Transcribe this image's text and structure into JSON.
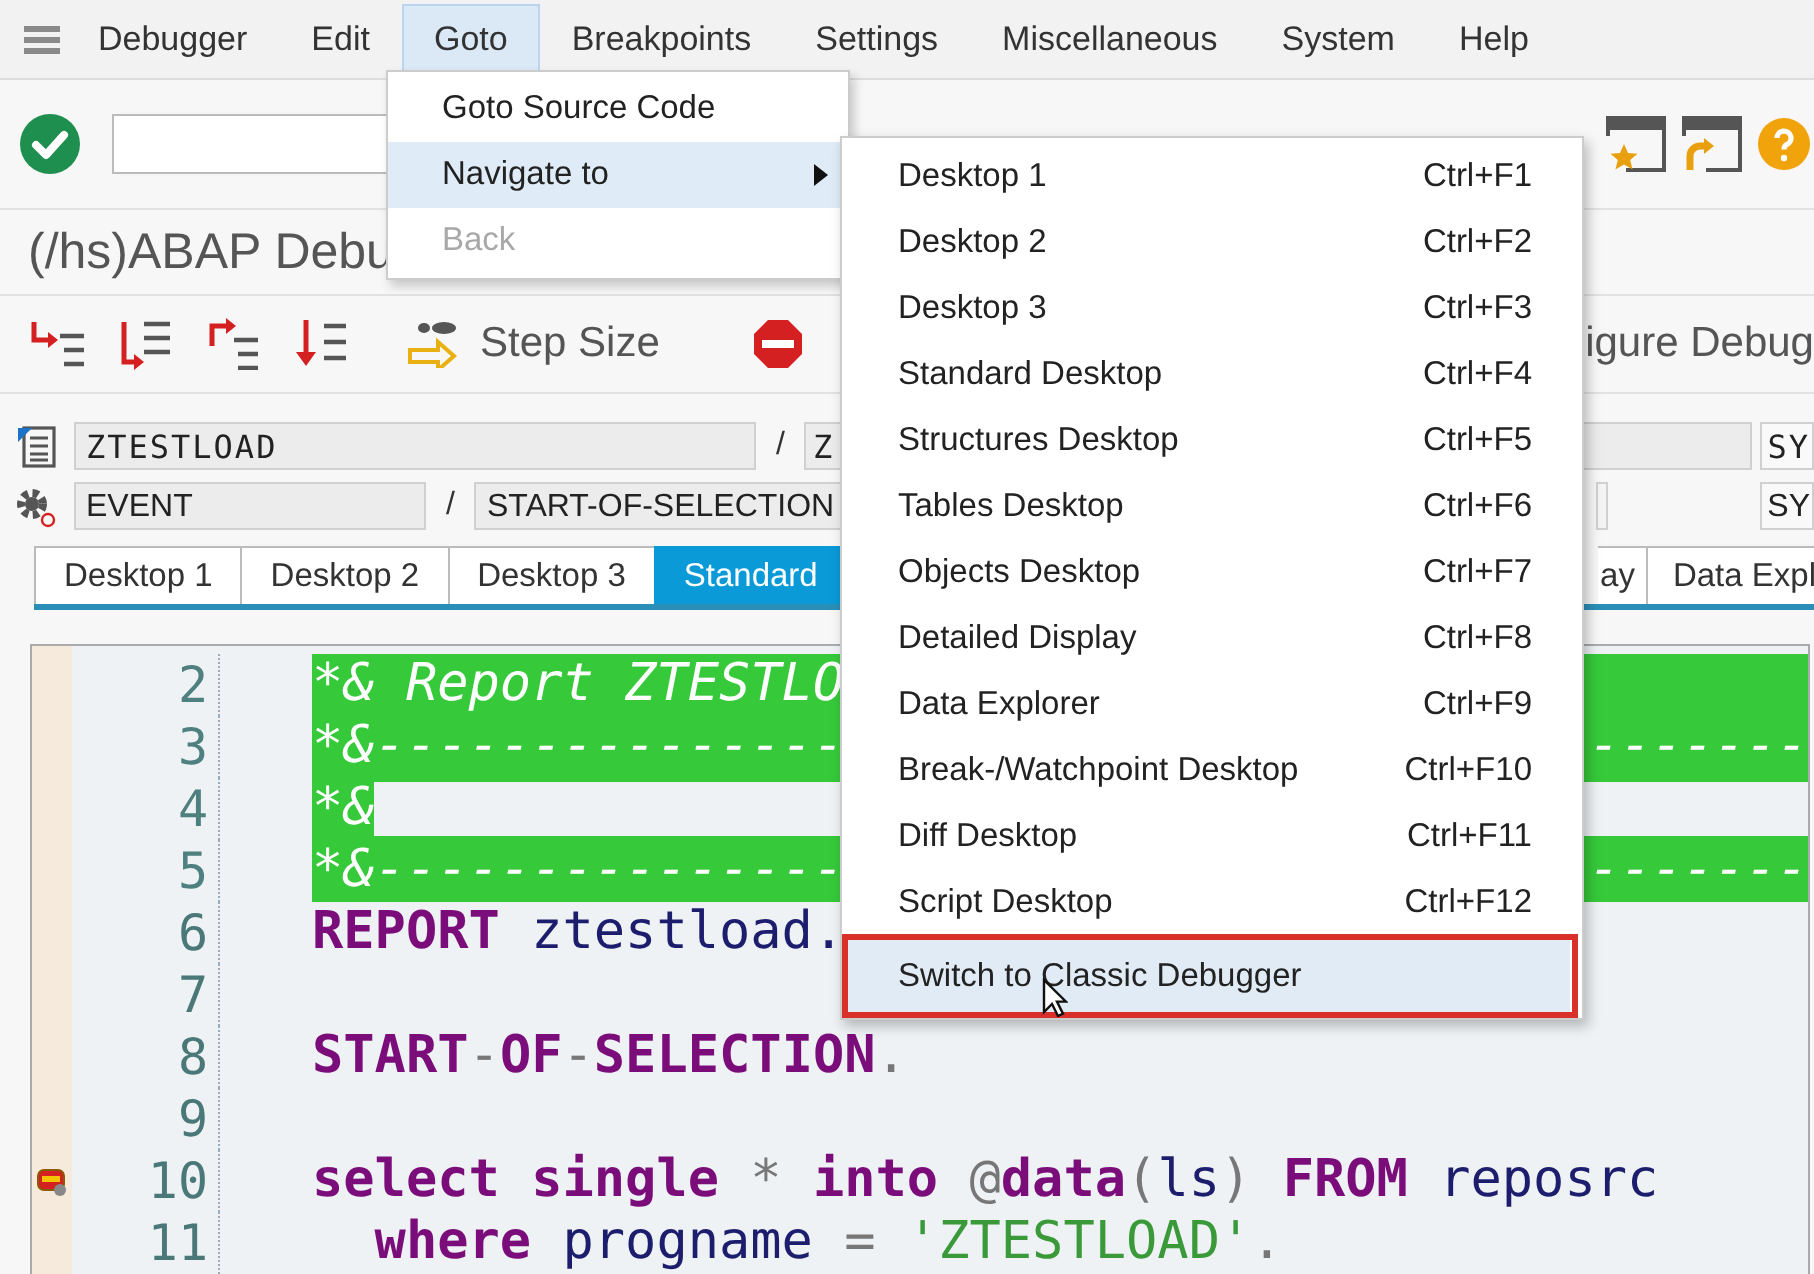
{
  "menu_bar": {
    "items": [
      {
        "label": "Debugger",
        "selected": false
      },
      {
        "label": "Edit",
        "selected": false
      },
      {
        "label": "Goto",
        "selected": true
      },
      {
        "label": "Breakpoints",
        "selected": false
      },
      {
        "label": "Settings",
        "selected": false
      },
      {
        "label": "Miscellaneous",
        "selected": false
      },
      {
        "label": "System",
        "selected": false
      },
      {
        "label": "Help",
        "selected": false
      }
    ]
  },
  "title": "(/hs)ABAP Debu",
  "step_toolbar": {
    "step_size": "Step Size",
    "configure": "igure Debug"
  },
  "context_rows": [
    {
      "kind": "program",
      "left": "ZTESTLOAD",
      "separator": "/",
      "middle": "Z",
      "right": [
        {
          "kind": "blank"
        },
        {
          "kind": "text",
          "value": "SY"
        }
      ]
    },
    {
      "kind": "event",
      "left": "EVENT",
      "separator": "/",
      "middle": "START-OF-SELECTION",
      "right": [
        {
          "kind": "stub"
        },
        {
          "kind": "text",
          "value": "SY"
        }
      ]
    }
  ],
  "tabs": {
    "left": [
      {
        "label": "Desktop 1",
        "selected": false
      },
      {
        "label": "Desktop 2",
        "selected": false
      },
      {
        "label": "Desktop 3",
        "selected": false
      },
      {
        "label": "Standard",
        "selected": true
      }
    ],
    "right": [
      {
        "label": "ay",
        "selected": false
      },
      {
        "label": "Data Expl",
        "selected": false
      }
    ]
  },
  "editor": {
    "lines": [
      {
        "number": "2",
        "kind": "comment",
        "tokens": [
          {
            "text": "*& Report ZTESTLO",
            "kind": "comment"
          }
        ]
      },
      {
        "number": "3",
        "kind": "comment",
        "tokens": [
          {
            "text": "*&---------------",
            "kind": "comment"
          }
        ],
        "tail": "-------"
      },
      {
        "number": "4",
        "kind": "comment",
        "tokens": [
          {
            "text": "*&",
            "kind": "comment"
          }
        ],
        "blank_rest": true
      },
      {
        "number": "5",
        "kind": "comment",
        "tokens": [
          {
            "text": "*&---------------",
            "kind": "comment"
          }
        ],
        "tail": "-------"
      },
      {
        "number": "6",
        "kind": "code",
        "tokens": [
          {
            "text": "REPORT",
            "kind": "keyword"
          },
          {
            "text": " ztestload.",
            "kind": "identifier"
          }
        ]
      },
      {
        "number": "7",
        "kind": "code"
      },
      {
        "number": "8",
        "kind": "code",
        "tokens": [
          {
            "text": "START",
            "kind": "keyword"
          },
          {
            "text": "-",
            "kind": "operator"
          },
          {
            "text": "OF",
            "kind": "keyword"
          },
          {
            "text": "-",
            "kind": "operator"
          },
          {
            "text": "SELECTION",
            "kind": "keyword"
          },
          {
            "text": ".",
            "kind": "operator"
          }
        ]
      },
      {
        "number": "9",
        "kind": "code"
      },
      {
        "number": "10",
        "kind": "code",
        "breakpoint": true,
        "tokens": [
          {
            "text": "select single ",
            "kind": "keyword"
          },
          {
            "text": "* ",
            "kind": "operator"
          },
          {
            "text": "into ",
            "kind": "keyword"
          },
          {
            "text": "@",
            "kind": "operator"
          },
          {
            "text": "data",
            "kind": "keyword"
          },
          {
            "text": "(",
            "kind": "operator"
          },
          {
            "text": "ls",
            "kind": "identifier"
          },
          {
            "text": ") ",
            "kind": "operator"
          },
          {
            "text": "FROM ",
            "kind": "keyword"
          },
          {
            "text": "reposrc",
            "kind": "identifier"
          }
        ]
      },
      {
        "number": "11",
        "kind": "code",
        "tokens": [
          {
            "text": "  where",
            "kind": "keyword"
          },
          {
            "text": " progname ",
            "kind": "identifier"
          },
          {
            "text": "= ",
            "kind": "operator"
          },
          {
            "text": "'ZTESTLOAD'",
            "kind": "string"
          },
          {
            "text": ".",
            "kind": "operator"
          }
        ]
      }
    ]
  },
  "goto_menu": {
    "items": [
      {
        "label": "Goto Source Code",
        "selected": false,
        "disabled": false,
        "submenu": false
      },
      {
        "label": "Navigate to",
        "selected": true,
        "disabled": false,
        "submenu": true
      },
      {
        "label": "Back",
        "selected": false,
        "disabled": true,
        "submenu": false
      }
    ]
  },
  "navigate_submenu": {
    "items": [
      {
        "label": "Desktop 1",
        "shortcut": "Ctrl+F1",
        "selected": false,
        "framed": false
      },
      {
        "label": "Desktop 2",
        "shortcut": "Ctrl+F2",
        "selected": false,
        "framed": false
      },
      {
        "label": "Desktop 3",
        "shortcut": "Ctrl+F3",
        "selected": false,
        "framed": false
      },
      {
        "label": "Standard Desktop",
        "shortcut": "Ctrl+F4",
        "selected": false,
        "framed": false
      },
      {
        "label": "Structures Desktop",
        "shortcut": "Ctrl+F5",
        "selected": false,
        "framed": false
      },
      {
        "label": "Tables Desktop",
        "shortcut": "Ctrl+F6",
        "selected": false,
        "framed": false
      },
      {
        "label": "Objects Desktop",
        "shortcut": "Ctrl+F7",
        "selected": false,
        "framed": false
      },
      {
        "label": "Detailed Display",
        "shortcut": "Ctrl+F8",
        "selected": false,
        "framed": false
      },
      {
        "label": "Data Explorer",
        "shortcut": "Ctrl+F9",
        "selected": false,
        "framed": false
      },
      {
        "label": "Break-/Watchpoint Desktop",
        "shortcut": "Ctrl+F10",
        "selected": false,
        "framed": false
      },
      {
        "label": "Diff Desktop",
        "shortcut": "Ctrl+F11",
        "selected": false,
        "framed": false
      },
      {
        "label": "Script Desktop",
        "shortcut": "Ctrl+F12",
        "selected": false,
        "framed": false
      },
      {
        "label": "Switch to Classic Debugger",
        "selected": true,
        "framed": true
      }
    ]
  }
}
